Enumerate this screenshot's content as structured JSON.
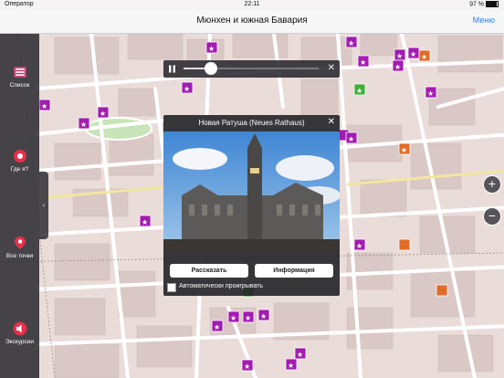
{
  "status_bar": {
    "carrier": "Оператор",
    "time": "22:11",
    "battery": "97 %"
  },
  "nav": {
    "title": "Мюнхен и южная Бавария",
    "menu_label": "Меню"
  },
  "sidebar": {
    "items": [
      {
        "label": "Список"
      },
      {
        "label": "Где я?"
      },
      {
        "label": "Все точки"
      },
      {
        "label": "Экскурсии"
      }
    ]
  },
  "player": {
    "progress": 0.2
  },
  "popup": {
    "title": "Новая Ратуша (Neues Rathaus)",
    "tell_label": "Рассказать",
    "info_label": "Информация",
    "auto_label": "Автоматически проигрывать",
    "auto_checked": false
  },
  "colors": {
    "poi_purple": "#a21cb0",
    "poi_orange": "#e06c28",
    "poi_green": "#3fae3a"
  }
}
